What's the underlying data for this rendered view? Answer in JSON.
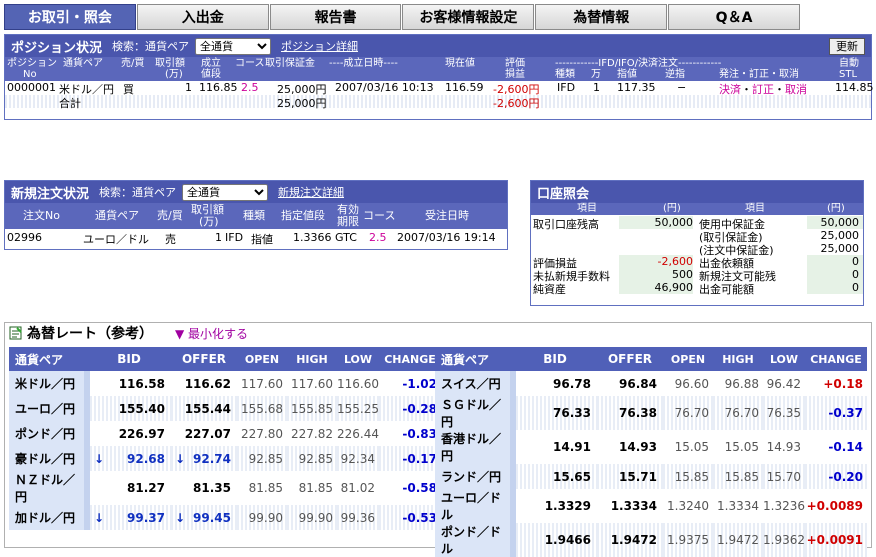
{
  "tabs": [
    "お取引・照会",
    "入出金",
    "報告書",
    "お客様情報設定",
    "為替情報",
    "Q＆A"
  ],
  "position": {
    "title": "ポジション状況",
    "search_label": "検索：通貨ペア",
    "select_value": "全通貨",
    "detail_link": "ポジション詳細",
    "refresh": "更新",
    "h1": [
      "ポジション",
      "通貨ペア",
      "売/買",
      "取引額",
      "成立",
      "コース",
      "取引保証金",
      "----成立日時----",
      "現在値",
      "評価",
      "",
      "------------IFD/IFO/決済注文------------",
      "",
      "",
      "",
      "自動"
    ],
    "h2": [
      "No",
      "",
      "",
      "(万)",
      "値段",
      "",
      "",
      "",
      "",
      "損益",
      "種類",
      "万",
      "指値",
      "逆指",
      "発注・訂正・取消",
      "STL"
    ],
    "row": {
      "no": "0000001",
      "pair": "米ドル／円",
      "side": "買",
      "amount": "1",
      "price": "116.85",
      "course": "2.5",
      "margin": "25,000円",
      "date": "2007/03/16 10:13",
      "current": "116.59",
      "pl": "-2,600円",
      "kind": "IFD",
      "qty": "1",
      "limit": "117.35",
      "stop": "−",
      "act1": "決済",
      "act2": "訂正",
      "act3": "取消",
      "sep": "・",
      "stl": "114.85"
    },
    "total": {
      "label": "合計",
      "margin": "25,000円",
      "pl": "-2,600円"
    }
  },
  "orders": {
    "title": "新規注文状況",
    "search_label": "検索：通貨ペア",
    "select_value": "全通貨",
    "detail_link": "新規注文詳細",
    "h": [
      "注文No",
      "通貨ペア",
      "売/買",
      "取引額",
      "種類",
      "指定値段",
      "有効",
      "コース",
      "受注日時"
    ],
    "h2": [
      "",
      "",
      "",
      "(万)",
      "",
      "",
      "期限",
      "",
      ""
    ],
    "row": {
      "no": "02996",
      "pair": "ユーロ／ドル",
      "side": "売",
      "amount": "1",
      "kind": "IFD",
      "type": "指値",
      "price": "1.3366",
      "valid": "GTC",
      "course": "2.5",
      "date": "2007/03/16 19:14"
    }
  },
  "account": {
    "title": "口座照会",
    "h": [
      "項目",
      "(円)",
      "項目",
      "(円)"
    ],
    "left": [
      [
        "取引口座残高",
        "50,000"
      ],
      [
        "",
        ""
      ],
      [
        "",
        ""
      ],
      [
        "評価損益",
        "-2,600"
      ],
      [
        "未払新規手数料",
        "500"
      ],
      [
        "純資産",
        "46,900"
      ]
    ],
    "right": [
      [
        "使用中保証金",
        "50,000"
      ],
      [
        "(取引保証金)",
        "25,000"
      ],
      [
        "(注文中保証金)",
        "25,000"
      ],
      [
        "出金依頼額",
        "0"
      ],
      [
        "新規注文可能残",
        "0"
      ],
      [
        "出金可能額",
        "0"
      ]
    ]
  },
  "rates": {
    "title": "為替レート（参考）",
    "minimize": "▼ 最小化する",
    "headers": [
      "通貨ペア",
      "BID",
      "OFFER",
      "OPEN",
      "HIGH",
      "LOW",
      "CHANGE"
    ],
    "left": [
      {
        "pair": "米ドル／円",
        "bid": "116.58",
        "offer": "116.62",
        "open": "117.60",
        "high": "117.60",
        "low": "116.60",
        "change": "-1.02",
        "down": false
      },
      {
        "pair": "ユーロ／円",
        "bid": "155.40",
        "offer": "155.44",
        "open": "155.68",
        "high": "155.85",
        "low": "155.25",
        "change": "-0.28",
        "down": false
      },
      {
        "pair": "ポンド／円",
        "bid": "226.97",
        "offer": "227.07",
        "open": "227.80",
        "high": "227.82",
        "low": "226.44",
        "change": "-0.83",
        "down": false
      },
      {
        "pair": "豪ドル／円",
        "bid": "92.68",
        "offer": "92.74",
        "open": "92.85",
        "high": "92.85",
        "low": "92.34",
        "change": "-0.17",
        "down": true
      },
      {
        "pair": "ＮＺドル／円",
        "bid": "81.27",
        "offer": "81.35",
        "open": "81.85",
        "high": "81.85",
        "low": "81.02",
        "change": "-0.58",
        "down": false
      },
      {
        "pair": "加ドル／円",
        "bid": "99.37",
        "offer": "99.45",
        "open": "99.90",
        "high": "99.90",
        "low": "99.36",
        "change": "-0.53",
        "down": true
      }
    ],
    "right": [
      {
        "pair": "スイス／円",
        "bid": "96.78",
        "offer": "96.84",
        "open": "96.60",
        "high": "96.88",
        "low": "96.42",
        "change": "+0.18",
        "down": false
      },
      {
        "pair": "ＳＧドル／円",
        "bid": "76.33",
        "offer": "76.38",
        "open": "76.70",
        "high": "76.70",
        "low": "76.35",
        "change": "-0.37",
        "down": false
      },
      {
        "pair": "香港ドル／円",
        "bid": "14.91",
        "offer": "14.93",
        "open": "15.05",
        "high": "15.05",
        "low": "14.93",
        "change": "-0.14",
        "down": false
      },
      {
        "pair": "ランド／円",
        "bid": "15.65",
        "offer": "15.71",
        "open": "15.85",
        "high": "15.85",
        "low": "15.70",
        "change": "-0.20",
        "down": false
      },
      {
        "pair": "ユーロ／ドル",
        "bid": "1.3329",
        "offer": "1.3334",
        "open": "1.3240",
        "high": "1.3334",
        "low": "1.3236",
        "change": "+0.0089",
        "down": false
      },
      {
        "pair": "ポンド／ドル",
        "bid": "1.9466",
        "offer": "1.9472",
        "open": "1.9375",
        "high": "1.9472",
        "low": "1.9362",
        "change": "+0.0091",
        "down": false
      }
    ],
    "arrow": "↓",
    "colors": {
      "negative": "#0000cc",
      "positive": "#d00000"
    }
  }
}
